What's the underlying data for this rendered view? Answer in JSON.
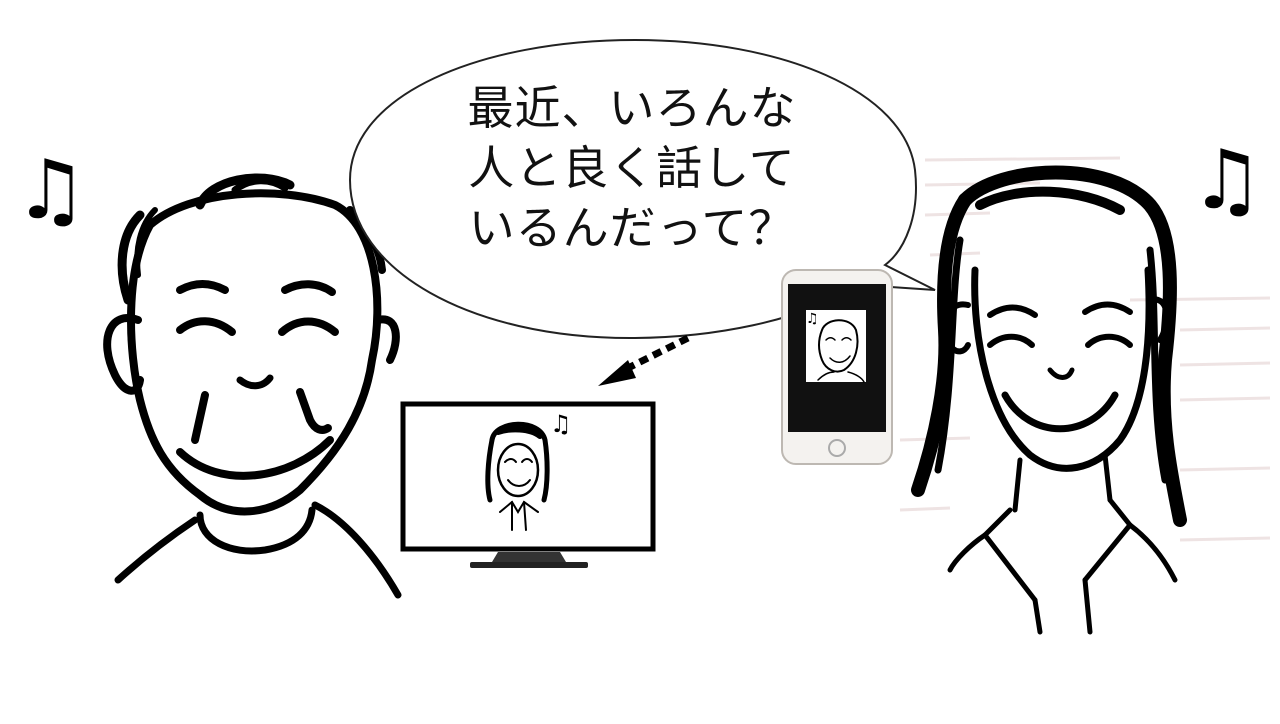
{
  "speech_bubble": {
    "lines": [
      "最近、いろんな",
      "人と良く話して",
      "いるんだって？"
    ]
  },
  "music_note_glyph": "♫",
  "colors": {
    "ink": "#000000",
    "bubble_fill": "#ffffff",
    "bubble_stroke": "#222222",
    "tv_stand": "#333333",
    "phone_body": "#f4f2ef"
  }
}
